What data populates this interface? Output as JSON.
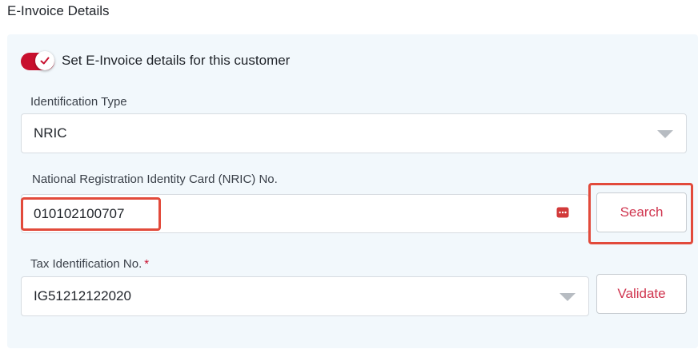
{
  "section": {
    "title": "E-Invoice Details"
  },
  "toggle": {
    "label": "Set E-Invoice details for this customer",
    "checked": true,
    "accent": "#c8102e"
  },
  "identification_type": {
    "label": "Identification Type",
    "value": "NRIC"
  },
  "nric": {
    "label": "National Registration Identity Card (NRIC) No.",
    "value": "010102100707",
    "icon": "id-card-icon"
  },
  "search": {
    "label": "Search"
  },
  "tin": {
    "label": "Tax Identification No.",
    "required_marker": "*",
    "value": "IG51212122020"
  },
  "validate": {
    "label": "Validate"
  },
  "colors": {
    "panel_bg": "#f2f8fc",
    "button_text": "#d0354f",
    "highlight": "#e24a3b"
  }
}
